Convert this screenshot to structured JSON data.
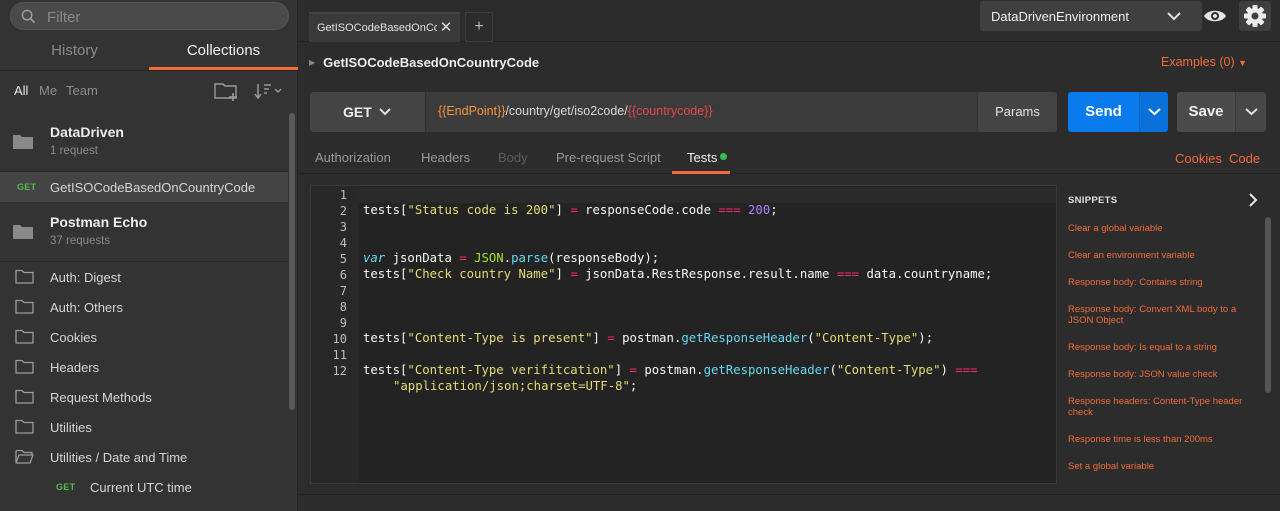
{
  "sidebar": {
    "filter_placeholder": "Filter",
    "tabs": [
      {
        "label": "History",
        "active": false
      },
      {
        "label": "Collections",
        "active": true
      }
    ],
    "scopes": [
      {
        "label": "All",
        "active": true
      },
      {
        "label": "Me",
        "active": false
      },
      {
        "label": "Team",
        "active": false
      }
    ],
    "collections": [
      {
        "name": "DataDriven",
        "count": "1 request"
      },
      {
        "name": "Postman Echo",
        "count": "37 requests"
      }
    ],
    "selected_request": {
      "method": "GET",
      "name": "GetISOCodeBasedOnCountryCode"
    },
    "folders": [
      "Auth: Digest",
      "Auth: Others",
      "Cookies",
      "Headers",
      "Request Methods",
      "Utilities",
      "Utilities / Date and Time"
    ],
    "sub_request": {
      "method": "GET",
      "name": "Current UTC time"
    }
  },
  "topbar": {
    "tab_label": "GetISOCodeBasedOnCountryCode",
    "add_tab": "+",
    "close": "✕",
    "environment": "DataDrivenEnvironment"
  },
  "request": {
    "title": "GetISOCodeBasedOnCountryCode",
    "examples": "Examples (0)",
    "method": "GET",
    "url_var1": "{{EndPoint}}",
    "url_path": "/country/get/iso2code/",
    "url_var2": "{{countrycode}}",
    "params": "Params",
    "send": "Send",
    "save": "Save"
  },
  "request_tabs": [
    {
      "label": "Authorization",
      "state": "normal"
    },
    {
      "label": "Headers",
      "state": "normal"
    },
    {
      "label": "Body",
      "state": "disabled"
    },
    {
      "label": "Pre-request Script",
      "state": "normal"
    },
    {
      "label": "Tests",
      "state": "active"
    }
  ],
  "links": {
    "cookies": "Cookies",
    "code": "Code"
  },
  "editor": {
    "line_numbers": [
      "1",
      "2",
      "3",
      "4",
      "5",
      "6",
      "7",
      "8",
      "9",
      "10",
      "11",
      "12"
    ],
    "lines": {
      "l2": {
        "t1": "tests[",
        "s1": "\"Status code is 200\"",
        "t2": "] ",
        "op1": "=",
        "t3": " responseCode.code ",
        "op2": "===",
        "num": " 200",
        "t4": ";"
      },
      "l5": {
        "kw": "var",
        "t1": " jsonData ",
        "op": "=",
        "obj": " JSON",
        "t2": ".",
        "fn": "parse",
        "t3": "(responseBody);"
      },
      "l6": {
        "t1": "tests[",
        "s1": "\"Check country Name\"",
        "t2": "] ",
        "op1": "=",
        "t3": " jsonData.RestResponse.result.name ",
        "op2": "===",
        "t4": " data.countryname;"
      },
      "l10": {
        "t1": "tests[",
        "s1": "\"Content-Type is present\"",
        "t2": "] ",
        "op1": "=",
        "t3": " postman.",
        "fn": "getResponseHeader",
        "t4": "(",
        "s2": "\"Content-Type\"",
        "t5": ");"
      },
      "l12": {
        "t1": "tests[",
        "s1": "\"Content-Type verifitcation\"",
        "t2": "] ",
        "op1": "=",
        "t3": " postman.",
        "fn": "getResponseHeader",
        "t4": "(",
        "s2": "\"Content-Type\"",
        "t5": ") ",
        "op2": "==="
      },
      "l12b": {
        "s1": "\"application/json;charset=UTF-8\"",
        "t1": ";"
      }
    }
  },
  "snippets": {
    "title": "SNIPPETS",
    "items": [
      "Clear a global variable",
      "Clear an environment variable",
      "Response body: Contains string",
      "Response body: Convert XML body to a JSON Object",
      "Response body: Is equal to a string",
      "Response body: JSON value check",
      "Response headers: Content-Type header check",
      "Response time is less than 200ms",
      "Set a global variable"
    ]
  },
  "colors": {
    "accent": "#f26b3a",
    "send": "#097bed",
    "get": "#56b94f",
    "tests_dot": "#2fbf52"
  }
}
